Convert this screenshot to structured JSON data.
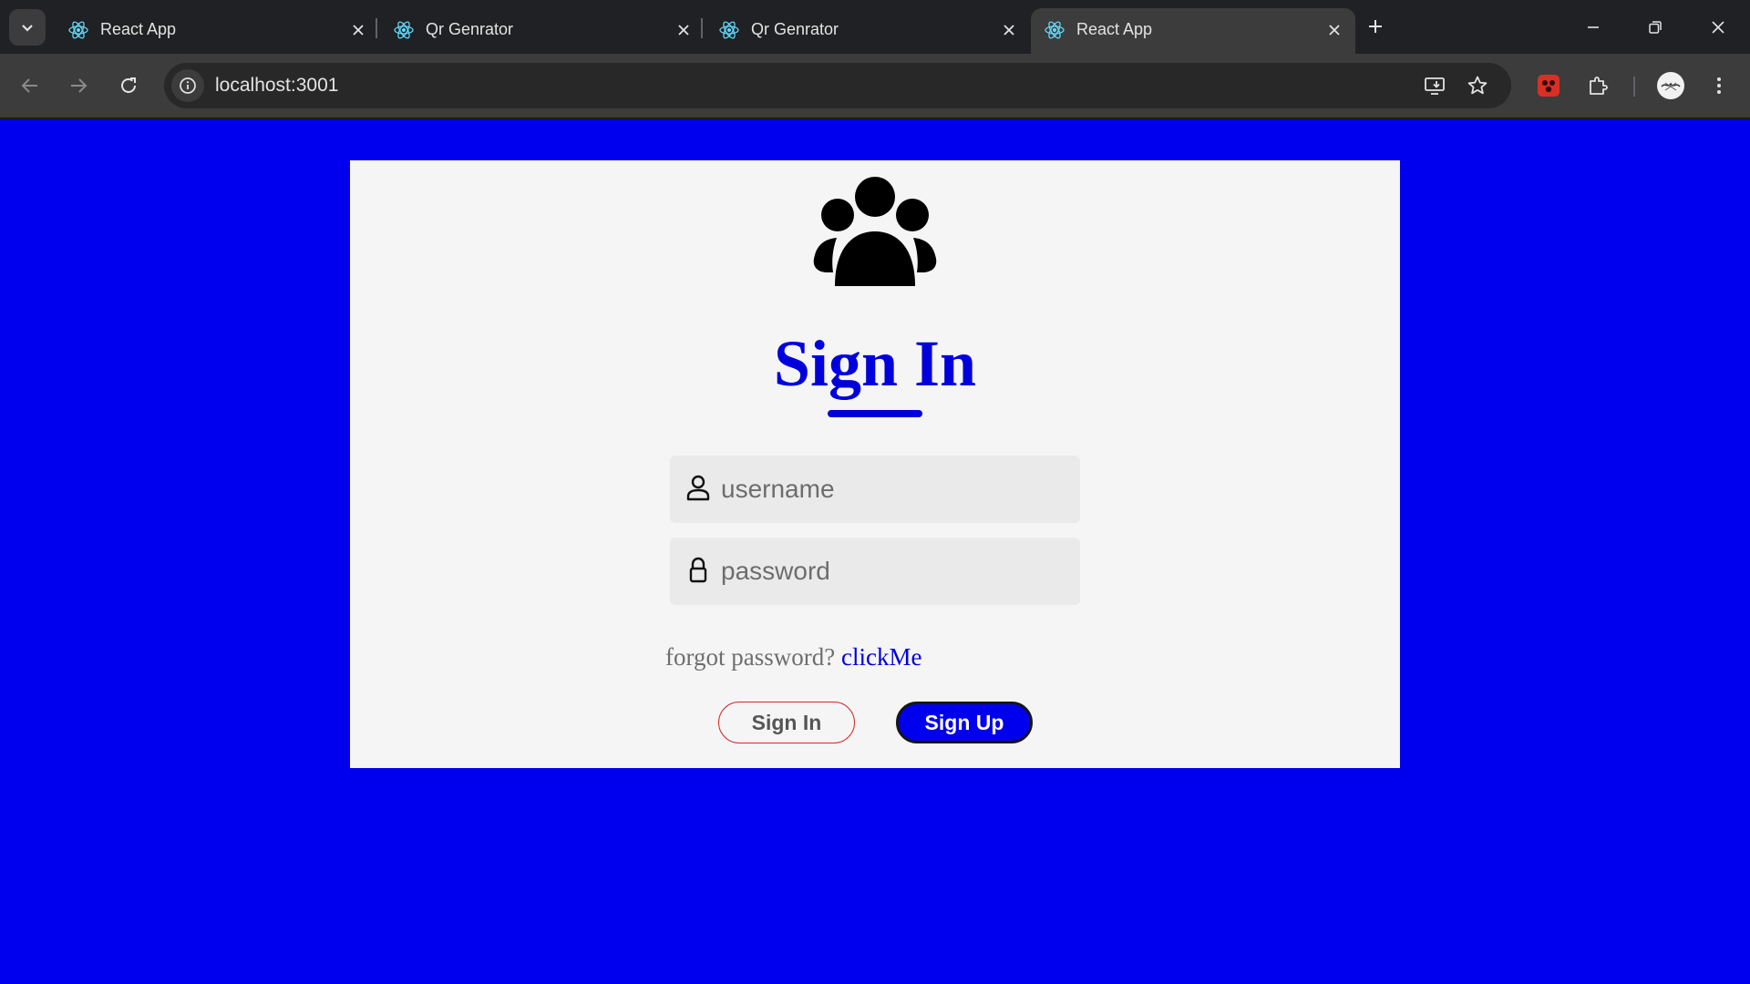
{
  "browser": {
    "tabs": [
      {
        "title": "React App",
        "active": false
      },
      {
        "title": "Qr Genrator",
        "active": false
      },
      {
        "title": "Qr Genrator",
        "active": false
      },
      {
        "title": "React App",
        "active": true
      }
    ],
    "url": "localhost:3001",
    "colors": {
      "chrome": "#202124",
      "toolbar": "#3c3c3c",
      "react_favicon": "#61dafb"
    }
  },
  "page": {
    "background": "#0000ee",
    "heading": "Sign In",
    "username": {
      "value": "",
      "placeholder": "username"
    },
    "password": {
      "value": "",
      "placeholder": "password"
    },
    "forgot_text": "forgot password?",
    "forgot_link": "clickMe",
    "signin_button": "Sign In",
    "signup_button": "Sign Up",
    "icons": {
      "logo": "users-group-icon",
      "username": "user-icon",
      "password": "lock-icon"
    }
  }
}
